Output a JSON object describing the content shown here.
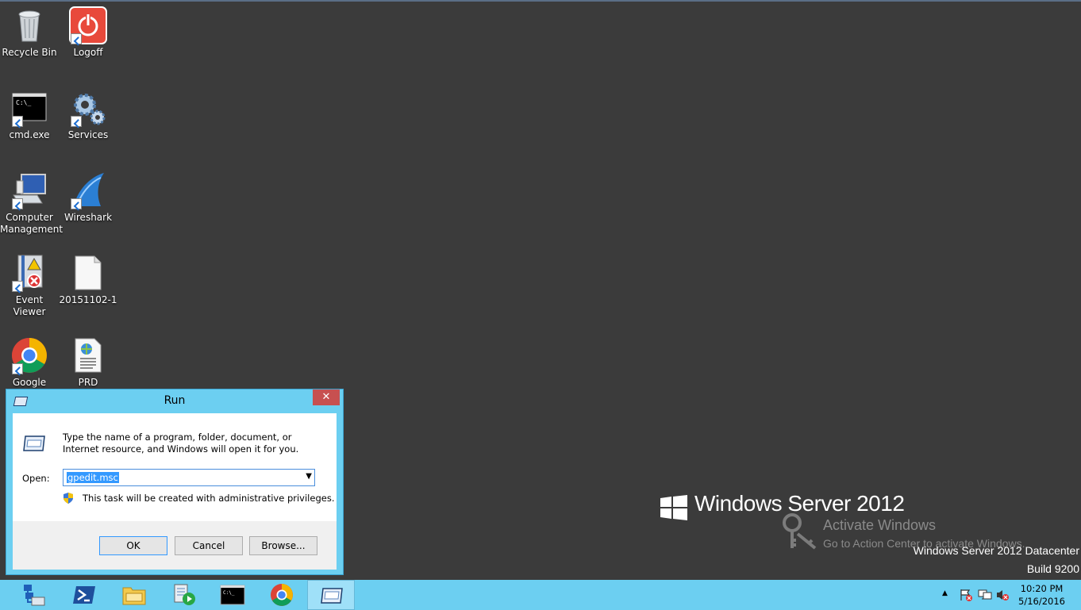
{
  "desktop": {
    "icons": [
      {
        "label": "Recycle Bin",
        "icon": "recycle-bin-icon"
      },
      {
        "label": "Logoff",
        "icon": "power-icon"
      },
      {
        "label": "cmd.exe",
        "icon": "cmd-icon"
      },
      {
        "label": "Services",
        "icon": "gears-icon"
      },
      {
        "label": "Computer Management",
        "icon": "computer-management-icon"
      },
      {
        "label": "Wireshark",
        "icon": "wireshark-fin-icon"
      },
      {
        "label": "Event Viewer",
        "icon": "event-viewer-icon"
      },
      {
        "label": "20151102-1",
        "icon": "text-file-icon"
      },
      {
        "label": "Google",
        "icon": "chrome-icon"
      },
      {
        "label": "PRD",
        "icon": "web-document-icon"
      }
    ]
  },
  "run_dialog": {
    "title": "Run",
    "close": "✕",
    "description": "Type the name of a program, folder, document, or Internet resource, and Windows will open it for you.",
    "open_label": "Open:",
    "open_value": "gpedit.msc",
    "admin_note": "This task will be created with administrative privileges.",
    "buttons": {
      "ok": "OK",
      "cancel": "Cancel",
      "browse": "Browse..."
    }
  },
  "branding": {
    "product": "Windows Server 2012",
    "activate_title": "Activate Windows",
    "activate_sub": "Go to Action Center to activate Windows.",
    "edition": "Windows Server 2012 Datacenter",
    "build": "Build 9200"
  },
  "taskbar": {
    "items": [
      "server-manager-icon",
      "powershell-icon",
      "file-explorer-icon",
      "media-player-icon",
      "cmd-icon",
      "chrome-icon",
      "run-icon"
    ],
    "clock_time": "10:20 PM",
    "clock_date": "5/16/2016"
  },
  "colors": {
    "taskbar": "#6ccff1",
    "desktop": "#3b3b3b",
    "close": "#c75050"
  }
}
